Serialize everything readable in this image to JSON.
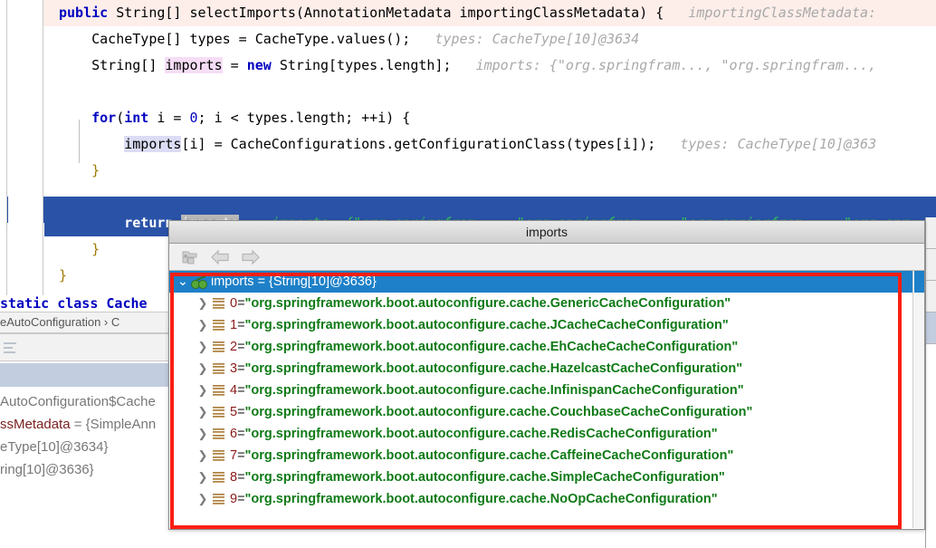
{
  "editor": {
    "lines": [
      {
        "id": "line-signature",
        "style": "caret",
        "segments": [
          {
            "t": "public ",
            "c": "kw"
          },
          {
            "t": "String[] selectImports(AnnotationMetadata importingClassMetadata) { ",
            "c": "plain"
          },
          {
            "t": "  importingClassMetadata:",
            "c": "hint"
          }
        ]
      },
      {
        "id": "line-cachetype",
        "style": "plain",
        "segments": [
          {
            "t": "    CacheType[] types = CacheType.values();  ",
            "c": "plain"
          },
          {
            "t": " types: CacheType[10]@3634",
            "c": "hint"
          }
        ]
      },
      {
        "id": "line-stringimports",
        "style": "plain",
        "segments": [
          {
            "t": "    String[] ",
            "c": "plain"
          },
          {
            "t": "imports",
            "c": "sel-pink"
          },
          {
            "t": " = ",
            "c": "plain"
          },
          {
            "t": "new",
            "c": "kw"
          },
          {
            "t": " String[types.length];  ",
            "c": "plain"
          },
          {
            "t": " imports: {\"org.springfram..., \"org.springfram...,",
            "c": "hint"
          }
        ]
      },
      {
        "id": "line-blank-1",
        "style": "plain",
        "segments": [
          {
            "t": " ",
            "c": "plain"
          }
        ]
      },
      {
        "id": "line-for",
        "style": "plain",
        "segments": [
          {
            "t": "    ",
            "c": "plain"
          },
          {
            "t": "for",
            "c": "kw"
          },
          {
            "t": "(",
            "c": "plain"
          },
          {
            "t": "int",
            "c": "kw"
          },
          {
            "t": " i = ",
            "c": "plain"
          },
          {
            "t": "0",
            "c": "num"
          },
          {
            "t": "; i < types.length; ++i) {",
            "c": "plain"
          }
        ]
      },
      {
        "id": "line-assign",
        "style": "plain",
        "segments": [
          {
            "t": "        ",
            "c": "plain"
          },
          {
            "t": "imports",
            "c": "sel-lav"
          },
          {
            "t": "[i] = CacheConfigurations.getConfigurationClass(types[i]);  ",
            "c": "plain"
          },
          {
            "t": " types: CacheType[10]@363",
            "c": "hint"
          }
        ]
      },
      {
        "id": "line-close-for",
        "style": "plain",
        "segments": [
          {
            "t": "    ",
            "c": "plain"
          },
          {
            "t": "}",
            "c": "brace-y"
          }
        ]
      },
      {
        "id": "line-blank-2",
        "style": "plain",
        "segments": [
          {
            "t": " ",
            "c": "plain"
          }
        ]
      },
      {
        "id": "line-return",
        "style": "exec",
        "segments": [
          {
            "t": "        ",
            "c": "plain"
          },
          {
            "t": "return",
            "c": "plain-bold"
          },
          {
            "t": " ",
            "c": "plain"
          },
          {
            "t": "imports",
            "c": "sel-gray"
          },
          {
            "t": "; ",
            "c": "plain"
          },
          {
            "t": "  imports: {\"org.springfram..., \"org.springfram..., \"org.springfram..., \"org.spr",
            "c": "hint-exec"
          }
        ]
      },
      {
        "id": "line-close-method",
        "style": "plain",
        "segments": [
          {
            "t": "    ",
            "c": "plain"
          },
          {
            "t": "}",
            "c": "brace-y"
          }
        ]
      },
      {
        "id": "line-close-class",
        "style": "plain",
        "segments": [
          {
            "t": "}",
            "c": "brace-y"
          }
        ]
      }
    ]
  },
  "background": {
    "code_strip": "static class Cache",
    "breadcrumb": "eAutoConfiguration  ›  C",
    "variables": [
      {
        "name": "",
        "text": "AutoConfiguration$Cache"
      },
      {
        "name": "ssMetadata",
        "text": " = {SimpleAnn"
      },
      {
        "name": "",
        "text": "eType[10]@3634}"
      },
      {
        "name": "",
        "text": "ring[10]@3636}"
      }
    ]
  },
  "popup": {
    "title": "imports",
    "toolbar": [
      {
        "name": "set-value-icon",
        "label": "Set Value"
      },
      {
        "name": "arrow-left-icon",
        "label": "Back"
      },
      {
        "name": "arrow-right-icon",
        "label": "Forward"
      }
    ],
    "root": {
      "expanded_caret": "⌄",
      "icon": "watch-glasses-icon",
      "label": "imports = {String[10]@3636}"
    },
    "items": [
      {
        "index": "0",
        "eq": "=",
        "value": "\"org.springframework.boot.autoconfigure.cache.GenericCacheConfiguration\""
      },
      {
        "index": "1",
        "eq": "=",
        "value": "\"org.springframework.boot.autoconfigure.cache.JCacheCacheConfiguration\""
      },
      {
        "index": "2",
        "eq": "=",
        "value": "\"org.springframework.boot.autoconfigure.cache.EhCacheCacheConfiguration\""
      },
      {
        "index": "3",
        "eq": "=",
        "value": "\"org.springframework.boot.autoconfigure.cache.HazelcastCacheConfiguration\""
      },
      {
        "index": "4",
        "eq": "=",
        "value": "\"org.springframework.boot.autoconfigure.cache.InfinispanCacheConfiguration\""
      },
      {
        "index": "5",
        "eq": "=",
        "value": "\"org.springframework.boot.autoconfigure.cache.CouchbaseCacheConfiguration\""
      },
      {
        "index": "6",
        "eq": "=",
        "value": "\"org.springframework.boot.autoconfigure.cache.RedisCacheConfiguration\""
      },
      {
        "index": "7",
        "eq": "=",
        "value": "\"org.springframework.boot.autoconfigure.cache.CaffeineCacheConfiguration\""
      },
      {
        "index": "8",
        "eq": "=",
        "value": "\"org.springframework.boot.autoconfigure.cache.SimpleCacheConfiguration\""
      },
      {
        "index": "9",
        "eq": "=",
        "value": "\"org.springframework.boot.autoconfigure.cache.NoOpCacheConfiguration\""
      }
    ],
    "row_caret": "❯"
  },
  "annotation": {
    "color": "#fb1e11"
  },
  "colors": {
    "exec_line_bg": "#2a53a8",
    "caret_line_bg": "#fdeeea",
    "selection_blue": "#1e80c8",
    "string_green": "#0f7a16",
    "index_red": "#8b1a1a",
    "keyword_blue": "#0000c0",
    "hint_gray": "#a9a9a9",
    "hint_green": "#35c756"
  }
}
